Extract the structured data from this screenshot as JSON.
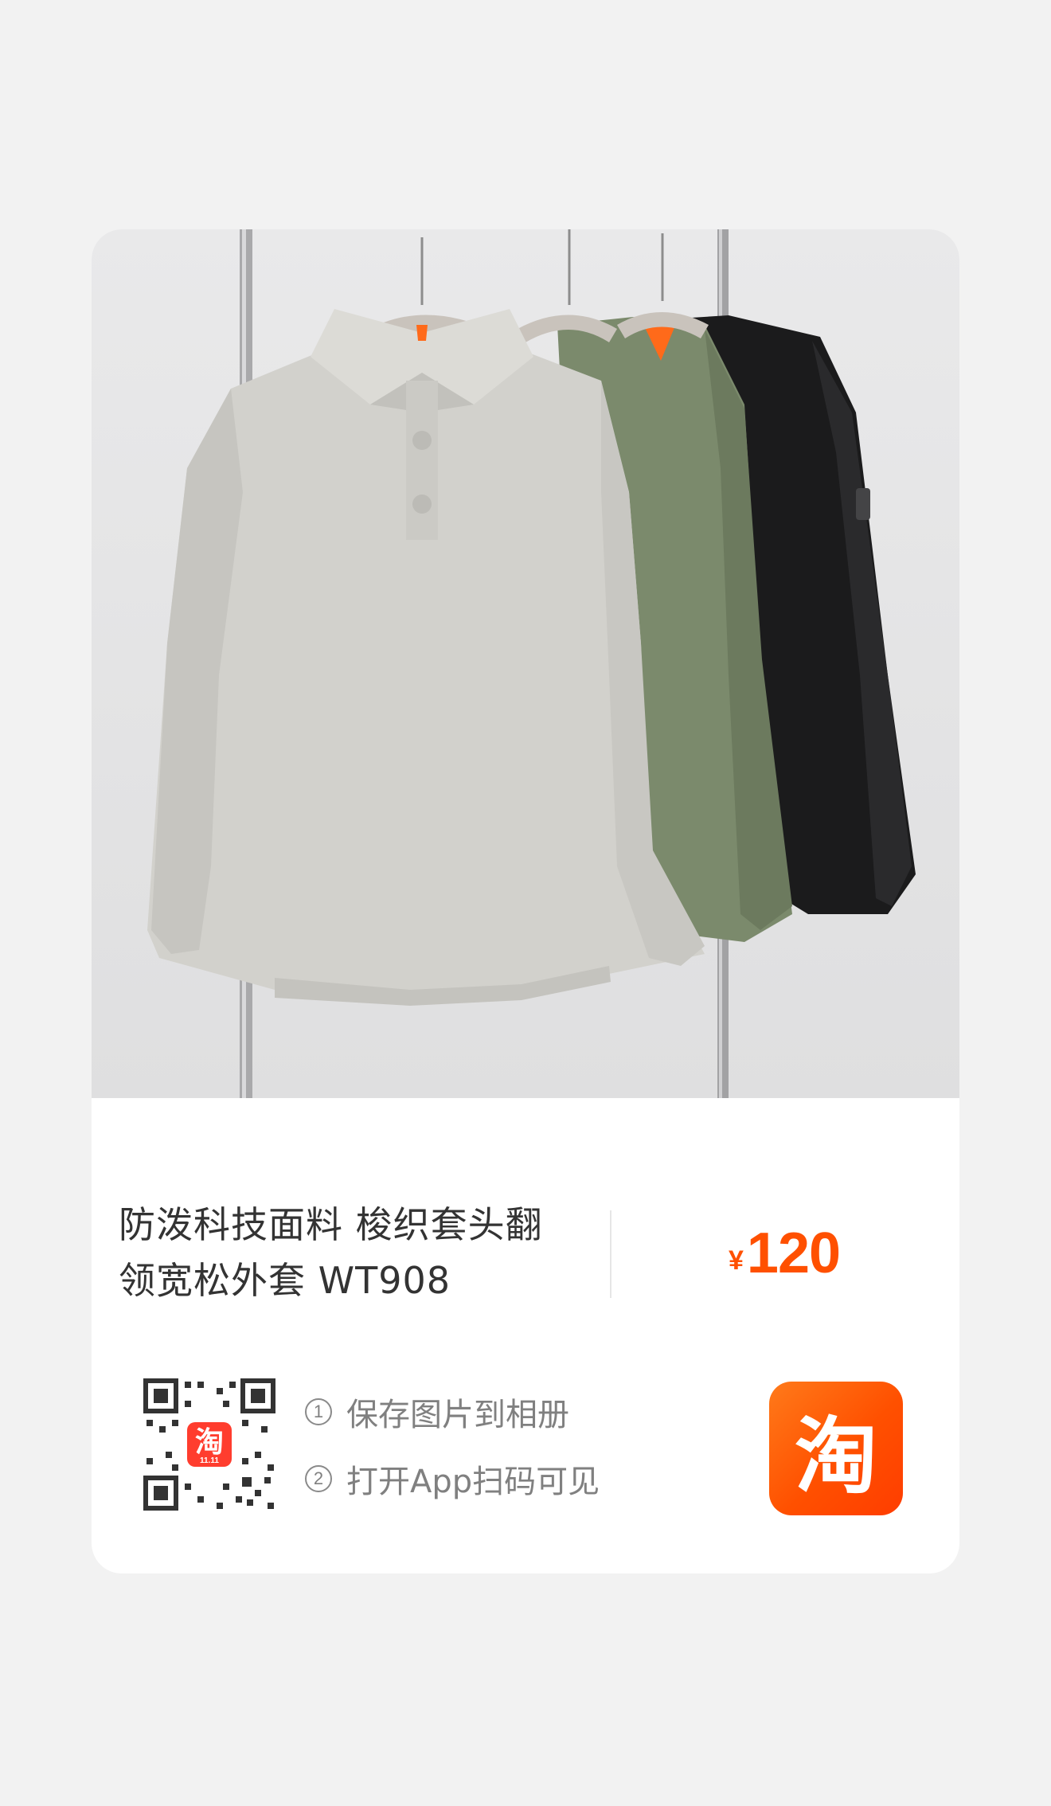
{
  "product": {
    "title_line1": "防泼科技面料 梭织套头翻",
    "title_line2": "领宽松外套 WT908",
    "currency": "¥",
    "price": "120"
  },
  "steps": [
    {
      "num": "1",
      "text": "保存图片到相册"
    },
    {
      "num": "2",
      "text": "打开App扫码可见"
    }
  ],
  "qr": {
    "center_badge_text": "淘",
    "center_badge_subtext": "11.11"
  },
  "taobao_logo": {
    "text": "淘"
  },
  "colors": {
    "accent": "#ff5000",
    "title_text": "#333333",
    "step_text": "#808080",
    "jacket_light": "#cfcfcb",
    "jacket_green": "#7b8a6c",
    "jacket_black": "#1b1b1c"
  },
  "icons": [
    "qr-code-icon",
    "taobao-app-icon"
  ]
}
